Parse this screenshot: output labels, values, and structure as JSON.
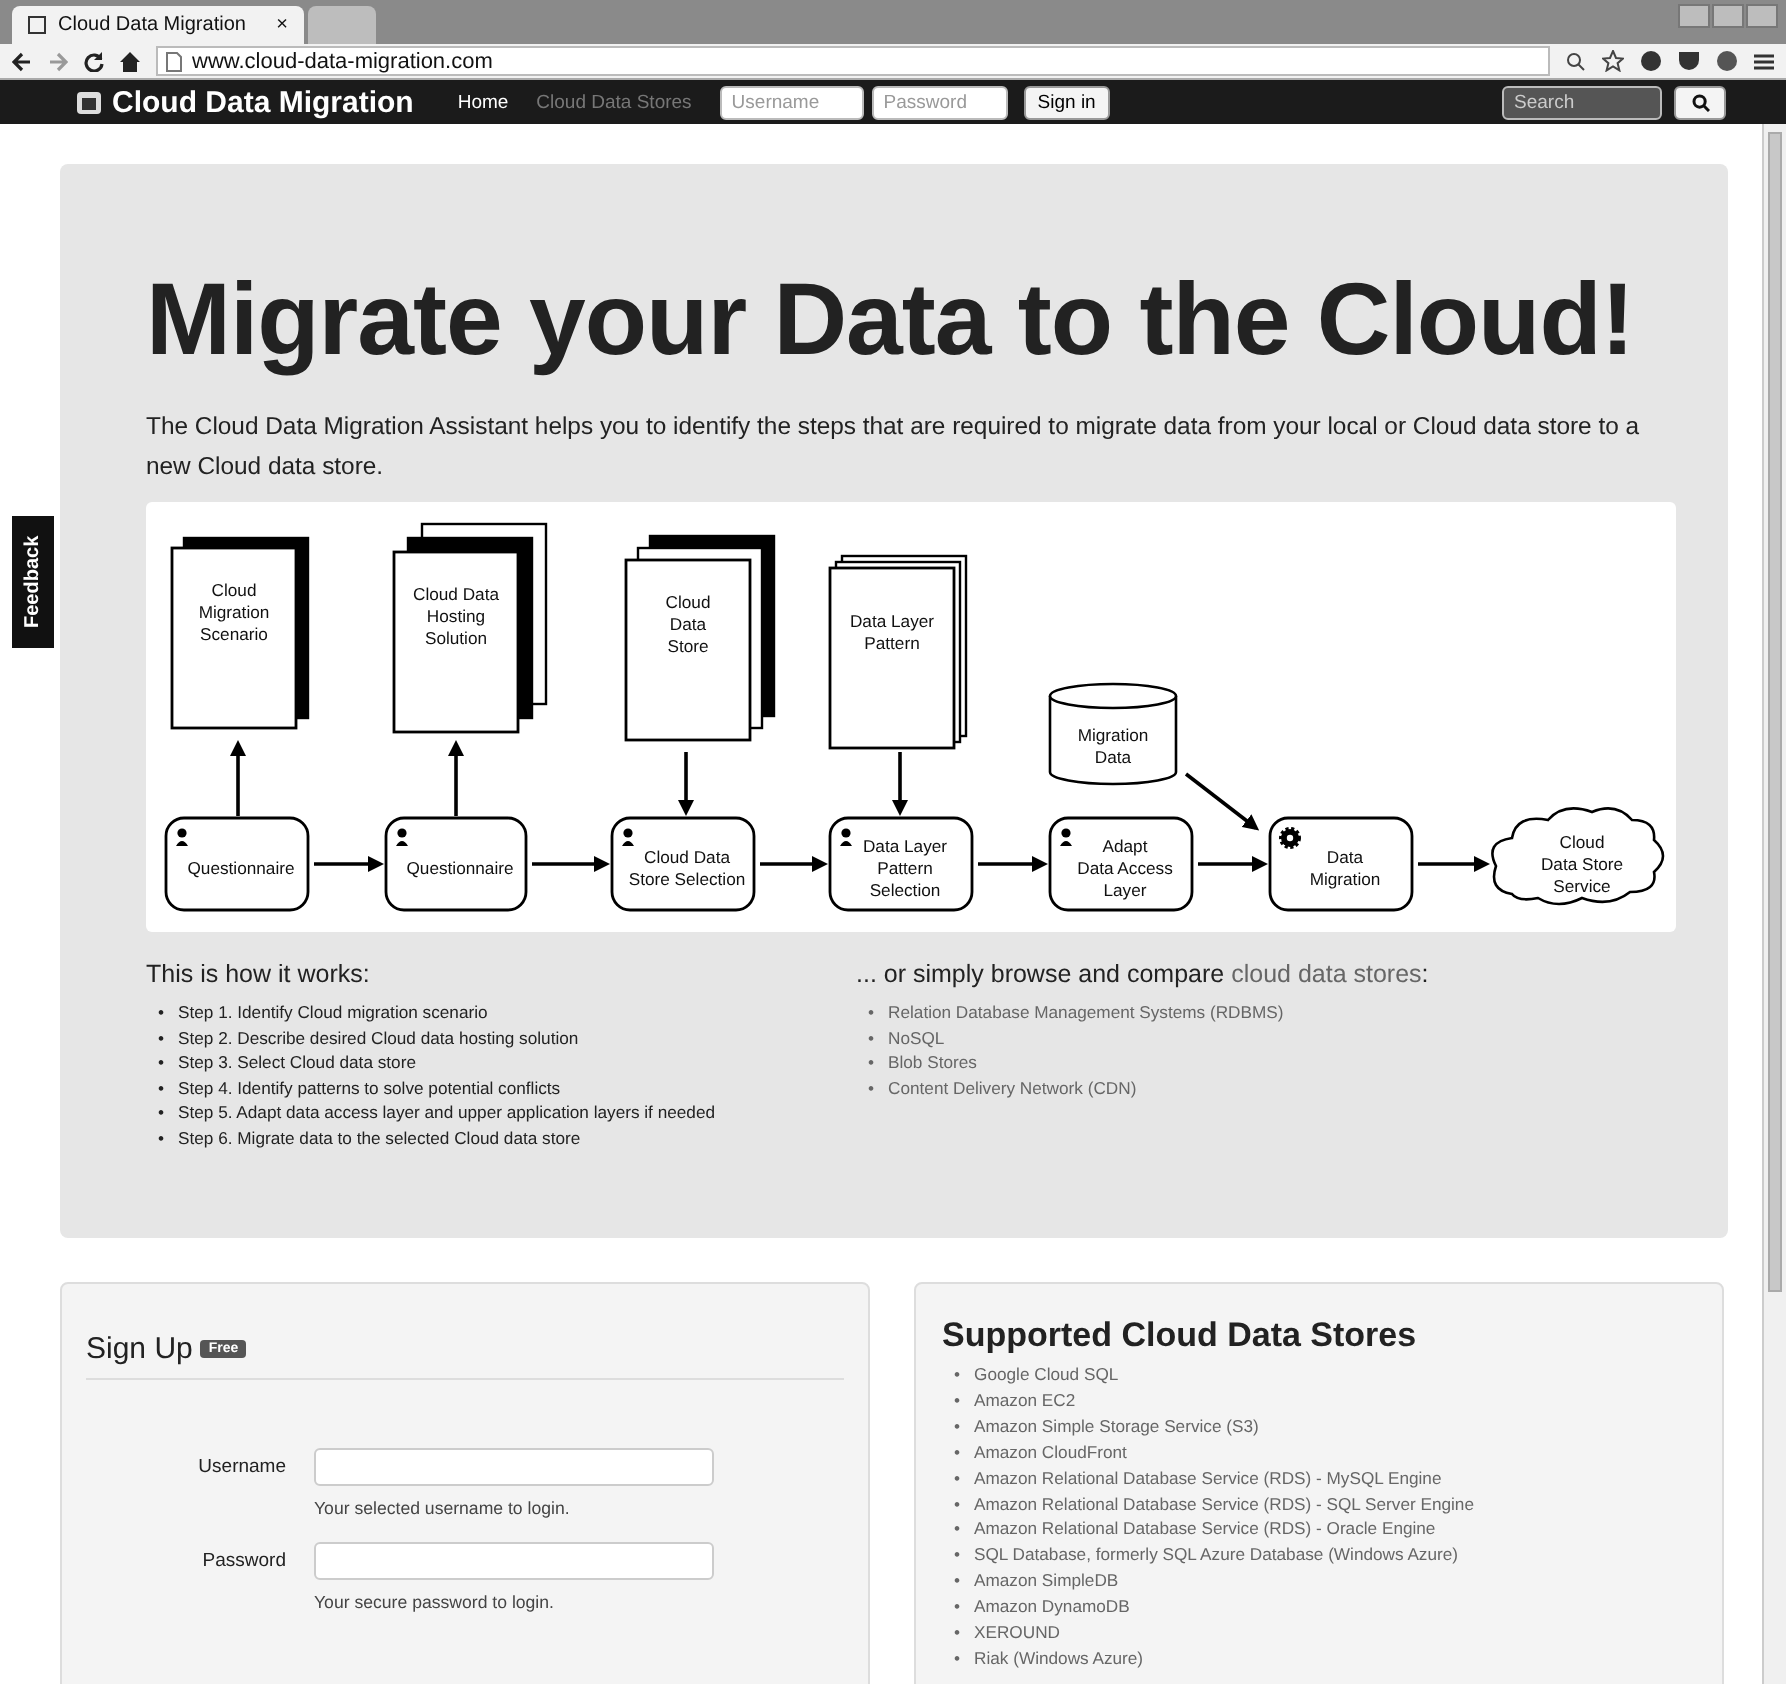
{
  "browser": {
    "tabs": [
      {
        "title": "Cloud Data Migration",
        "close": "×",
        "selected": true
      },
      {
        "selected": false
      }
    ],
    "address": "www.cloud-data-migration.com"
  },
  "navbar": {
    "brand": "Cloud Data Migration",
    "links": [
      {
        "label": "Home",
        "selected": true
      },
      {
        "label": "Cloud Data Stores",
        "selected": false
      }
    ],
    "username_placeholder": "Username",
    "password_placeholder": "Password",
    "signin": "Sign in",
    "search_placeholder": "Search"
  },
  "feedback": "Feedback",
  "hero": {
    "title": "Migrate your Data to the Cloud!",
    "description": "The Cloud Data Migration Assistant helps you to identify the steps that are required to migrate data from your local or Cloud data store to a new Cloud data store.",
    "diagram": {
      "documents": [
        {
          "lines": [
            "Cloud",
            "Migration",
            "Scenario"
          ]
        },
        {
          "lines": [
            "Cloud Data",
            "Hosting",
            "Solution"
          ]
        },
        {
          "lines": [
            "Cloud",
            "Data",
            "Store"
          ]
        },
        {
          "lines": [
            "Data Layer",
            "Pattern"
          ]
        }
      ],
      "database": {
        "lines": [
          "Migration",
          "Data"
        ]
      },
      "steps": [
        {
          "kind": "person",
          "lines": [
            "Questionnaire"
          ]
        },
        {
          "kind": "person",
          "lines": [
            "Questionnaire"
          ]
        },
        {
          "kind": "person",
          "lines": [
            "Cloud Data",
            "Store Selection"
          ]
        },
        {
          "kind": "person",
          "lines": [
            "Data Layer",
            "Pattern",
            "Selection"
          ]
        },
        {
          "kind": "person",
          "lines": [
            "Adapt",
            "Data Access",
            "Layer"
          ]
        },
        {
          "kind": "gear",
          "lines": [
            "Data",
            "Migration"
          ]
        }
      ],
      "cloud": {
        "lines": [
          "Cloud",
          "Data Store",
          "Service"
        ]
      }
    },
    "how": {
      "title": "This is how it works:",
      "bullet": "•",
      "steps": [
        "Step 1. Identify Cloud migration scenario",
        "Step 2. Describe desired Cloud data hosting solution",
        "Step 3. Select Cloud data store",
        "Step 4. Identify patterns to solve potential conflicts",
        "Step 5. Adapt data access layer and upper application layers if needed",
        "Step 6. Migrate data to the selected Cloud data store"
      ]
    },
    "browse": {
      "title": "... or simply browse and compare",
      "link": "cloud data stores",
      "colon": ":",
      "bullet": "•",
      "categories": [
        "Relation Database Management Systems (RDBMS)",
        "NoSQL",
        "Blob Stores",
        "Content Delivery Network (CDN)"
      ]
    }
  },
  "signup": {
    "title": "Sign Up",
    "badge": "Free",
    "fields": [
      {
        "label": "Username",
        "help": "Your selected username to login."
      },
      {
        "label": "Password",
        "help": "Your secure password to login."
      }
    ]
  },
  "supported": {
    "title": "Supported Cloud Data Stores",
    "bullet": "•",
    "items": [
      "Google Cloud SQL",
      "Amazon EC2",
      "Amazon Simple Storage Service (S3)",
      "Amazon CloudFront",
      "Amazon Relational Database Service (RDS) - MySQL Engine",
      "Amazon Relational Database Service (RDS) - SQL Server Engine",
      "Amazon Relational Database Service (RDS) - Oracle Engine",
      "SQL Database, formerly SQL Azure Database (Windows Azure)",
      "Amazon SimpleDB",
      "Amazon DynamoDB",
      "XEROUND",
      "Riak (Windows Azure)"
    ]
  }
}
